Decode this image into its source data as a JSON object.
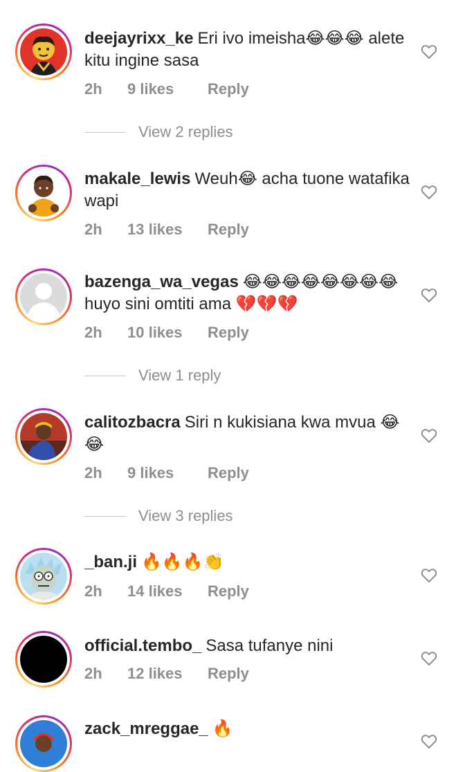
{
  "comments": [
    {
      "username": "deejayrixx_ke",
      "text": "Eri ivo imeisha😂😂😂 alete kitu ingine sasa",
      "time": "2h",
      "likes": "9 likes",
      "reply": "Reply",
      "view_replies": "View 2 replies"
    },
    {
      "username": "makale_lewis",
      "text": "Weuh😂 acha tuone watafika wapi",
      "time": "2h",
      "likes": "13 likes",
      "reply": "Reply"
    },
    {
      "username": "bazenga_wa_vegas",
      "text": "😂😂😂😂😂😂😂😂 huyo sini omtiti ama 💔💔💔",
      "time": "2h",
      "likes": "10 likes",
      "reply": "Reply",
      "view_replies": "View 1 reply"
    },
    {
      "username": "calitozbacra",
      "text": "Siri n kukisiana kwa mvua 😂😂",
      "time": "2h",
      "likes": "9 likes",
      "reply": "Reply",
      "view_replies": "View 3 replies"
    },
    {
      "username": "_ban.ji",
      "text": "🔥🔥🔥👏",
      "time": "2h",
      "likes": "14 likes",
      "reply": "Reply"
    },
    {
      "username": "official.tembo_",
      "text": "Sasa tufanye nini",
      "time": "2h",
      "likes": "12 likes",
      "reply": "Reply"
    },
    {
      "username": "zack_mreggae_",
      "text": "🔥"
    }
  ],
  "colors": {
    "text": "#262626",
    "secondary": "#8e8e8e",
    "divider": "#c7c7c7"
  },
  "icons": {
    "like": "heart-outline-icon"
  }
}
